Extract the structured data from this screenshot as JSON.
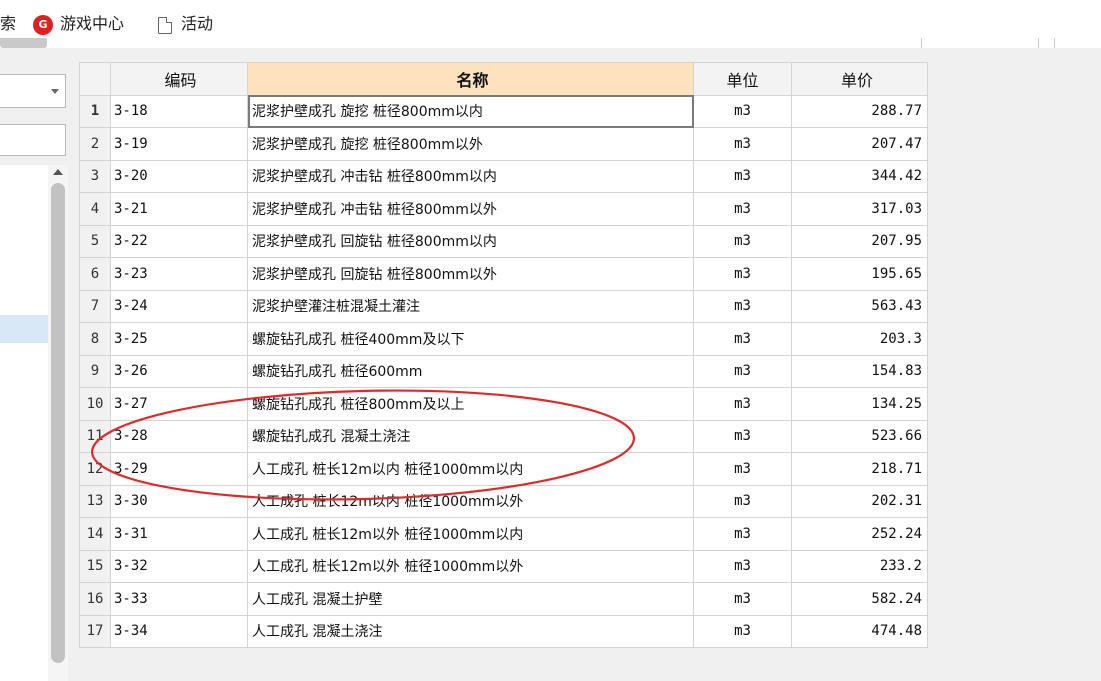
{
  "toolbar": {
    "search_fragment": "索",
    "game_center_label": "游戏中心",
    "game_icon_glyph": "G",
    "activity_label": "活动"
  },
  "grid": {
    "headers": {
      "index": "",
      "code": "编码",
      "name": "名称",
      "unit": "单位",
      "price": "单价"
    },
    "rows": [
      {
        "index": "1",
        "code": "3-18",
        "name": "泥浆护壁成孔 旋挖 桩径800mm以内",
        "unit": "m3",
        "price": "288.77"
      },
      {
        "index": "2",
        "code": "3-19",
        "name": "泥浆护壁成孔 旋挖 桩径800mm以外",
        "unit": "m3",
        "price": "207.47"
      },
      {
        "index": "3",
        "code": "3-20",
        "name": "泥浆护壁成孔 冲击钻 桩径800mm以内",
        "unit": "m3",
        "price": "344.42"
      },
      {
        "index": "4",
        "code": "3-21",
        "name": "泥浆护壁成孔 冲击钻 桩径800mm以外",
        "unit": "m3",
        "price": "317.03"
      },
      {
        "index": "5",
        "code": "3-22",
        "name": "泥浆护壁成孔 回旋钻 桩径800mm以内",
        "unit": "m3",
        "price": "207.95"
      },
      {
        "index": "6",
        "code": "3-23",
        "name": "泥浆护壁成孔 回旋钻 桩径800mm以外",
        "unit": "m3",
        "price": "195.65"
      },
      {
        "index": "7",
        "code": "3-24",
        "name": "泥浆护壁灌注桩混凝土灌注",
        "unit": "m3",
        "price": "563.43"
      },
      {
        "index": "8",
        "code": "3-25",
        "name": "螺旋钻孔成孔 桩径400mm及以下",
        "unit": "m3",
        "price": "203.3"
      },
      {
        "index": "9",
        "code": "3-26",
        "name": "螺旋钻孔成孔 桩径600mm",
        "unit": "m3",
        "price": "154.83"
      },
      {
        "index": "10",
        "code": "3-27",
        "name": "螺旋钻孔成孔 桩径800mm及以上",
        "unit": "m3",
        "price": "134.25"
      },
      {
        "index": "11",
        "code": "3-28",
        "name": "螺旋钻孔成孔 混凝土浇注",
        "unit": "m3",
        "price": "523.66"
      },
      {
        "index": "12",
        "code": "3-29",
        "name": "人工成孔 桩长12m以内 桩径1000mm以内",
        "unit": "m3",
        "price": "218.71"
      },
      {
        "index": "13",
        "code": "3-30",
        "name": "人工成孔 桩长12m以内 桩径1000mm以外",
        "unit": "m3",
        "price": "202.31"
      },
      {
        "index": "14",
        "code": "3-31",
        "name": "人工成孔 桩长12m以外 桩径1000mm以内",
        "unit": "m3",
        "price": "252.24"
      },
      {
        "index": "15",
        "code": "3-32",
        "name": "人工成孔 桩长12m以外 桩径1000mm以外",
        "unit": "m3",
        "price": "233.2"
      },
      {
        "index": "16",
        "code": "3-33",
        "name": "人工成孔 混凝土护壁",
        "unit": "m3",
        "price": "582.24"
      },
      {
        "index": "17",
        "code": "3-34",
        "name": "人工成孔 混凝土浇注",
        "unit": "m3",
        "price": "474.48"
      }
    ],
    "active_row": 1
  },
  "colors": {
    "name_header_bg": "#fde2bd",
    "annotation_oval": "#e02a2a",
    "game_icon": "#e02020",
    "tree_selection": "#d9e8f7"
  }
}
